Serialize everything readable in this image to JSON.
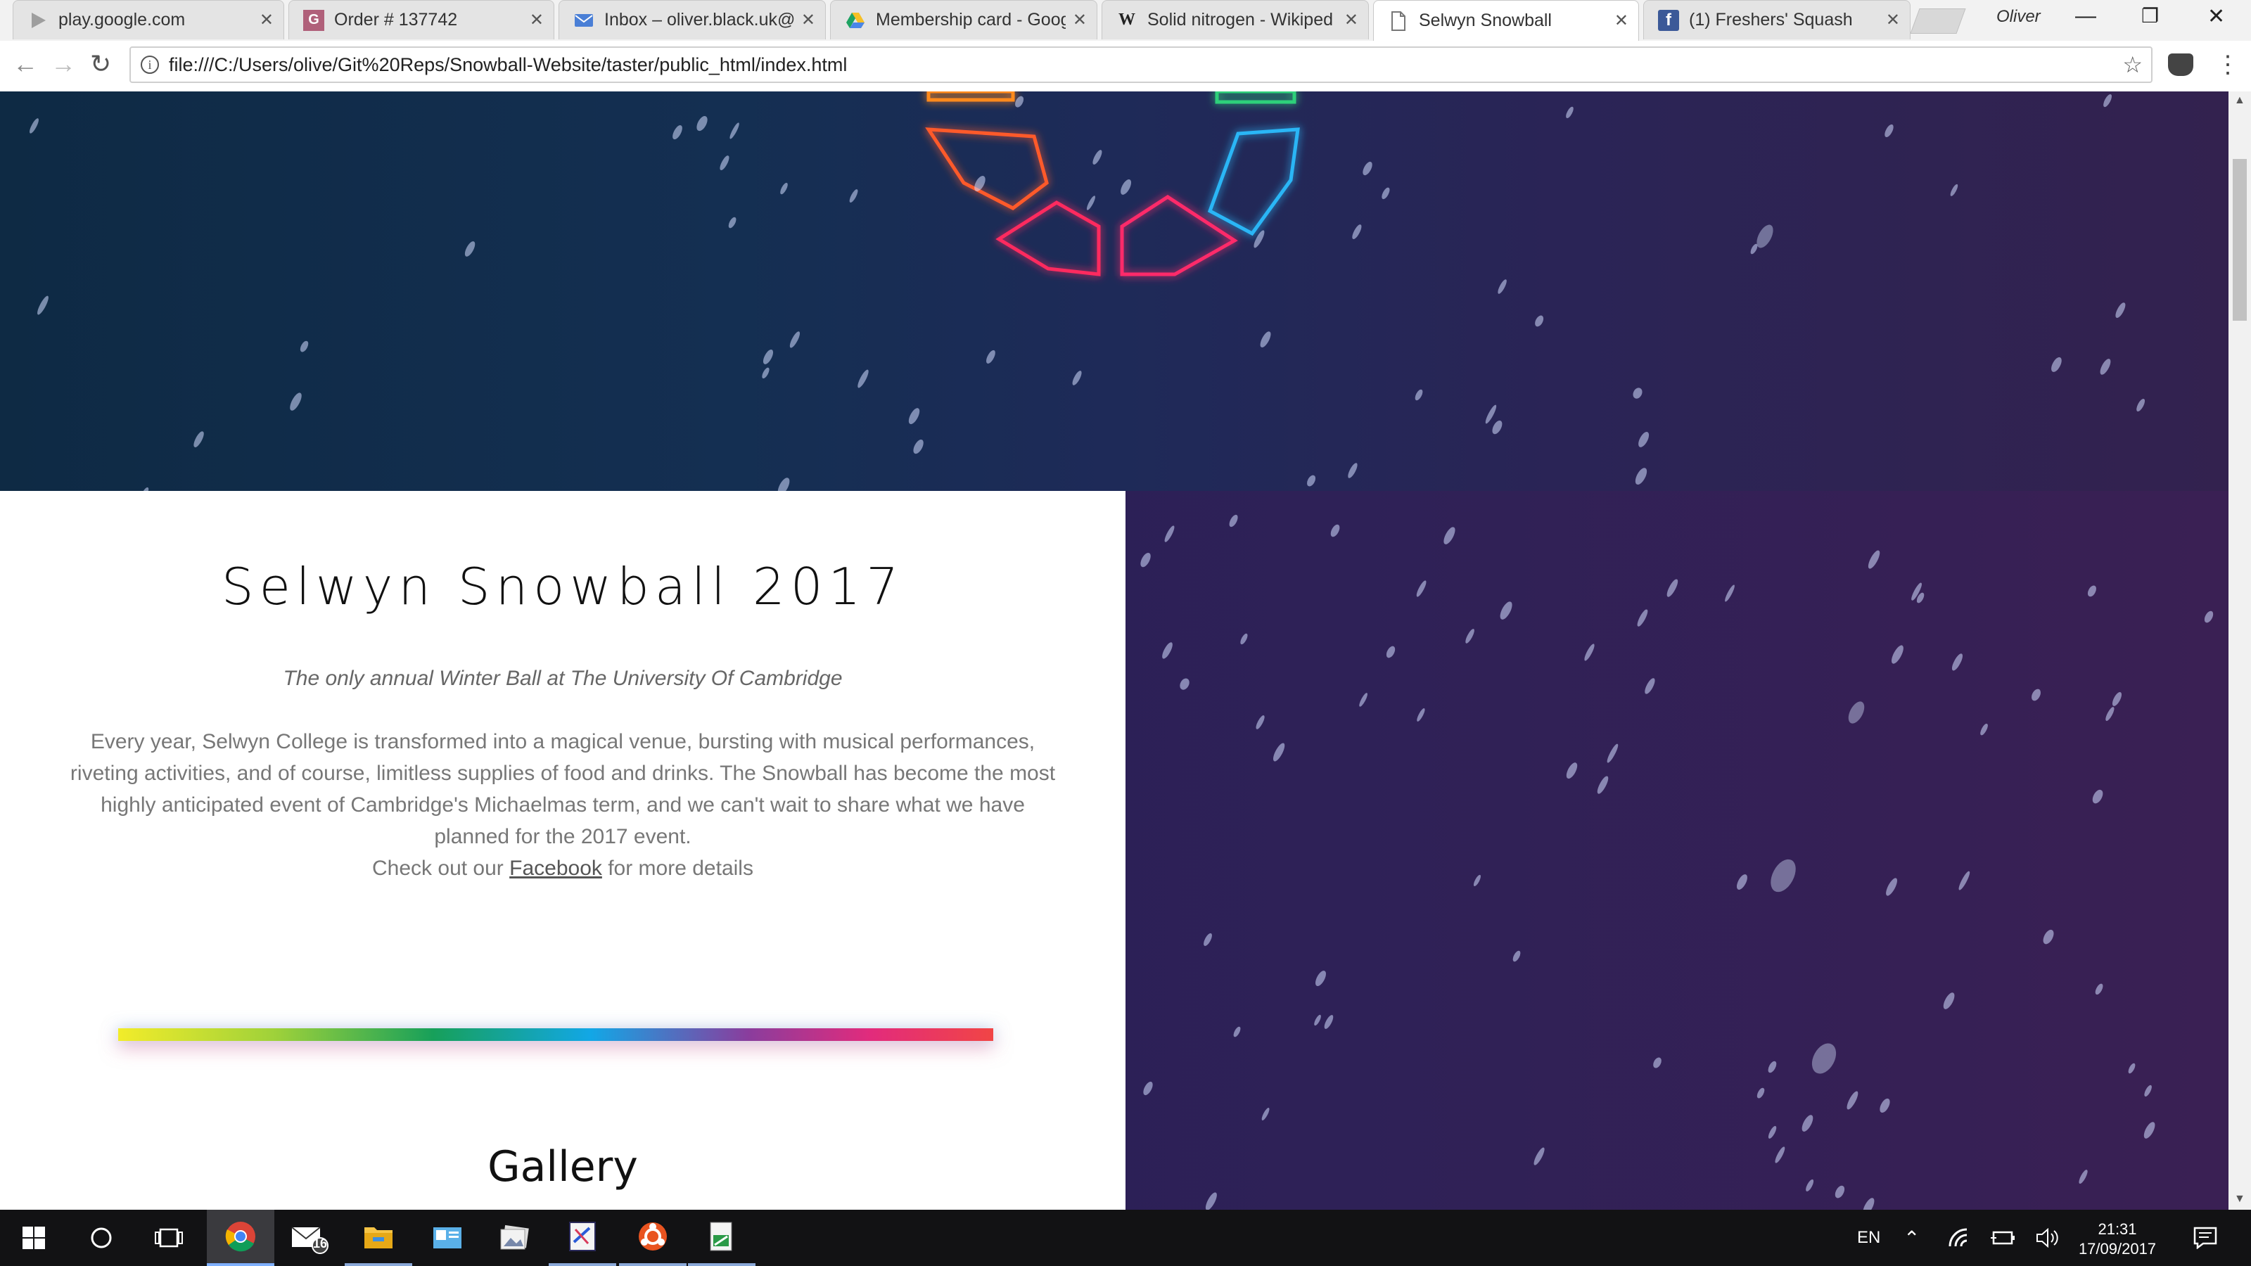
{
  "browser": {
    "tabs": [
      {
        "title": "play.google.com",
        "icon": "google-play-icon",
        "active": false
      },
      {
        "title": "Order # 137742",
        "icon": "g-square-icon",
        "active": false
      },
      {
        "title": "Inbox – oliver.black.uk@",
        "icon": "inbox-icon",
        "active": false
      },
      {
        "title": "Membership card - Goog",
        "icon": "google-drive-icon",
        "active": false
      },
      {
        "title": "Solid nitrogen - Wikiped",
        "icon": "wikipedia-icon",
        "active": false
      },
      {
        "title": "Selwyn Snowball",
        "icon": "document-icon",
        "active": true
      },
      {
        "title": "(1) Freshers' Squash",
        "icon": "facebook-icon",
        "active": false
      }
    ],
    "profile_name": "Oliver",
    "url": "file:///C:/Users/olive/Git%20Reps/Snowball-Website/taster/public_html/index.html"
  },
  "page": {
    "title": "Selwyn Snowball 2017",
    "tagline": "The only annual Winter Ball at The University Of Cambridge",
    "description": "Every year, Selwyn College is transformed into a magical venue, bursting with musical performances, riveting activities, and of course, limitless supplies of food and drinks. The Snowball has become the most highly anticipated event of Cambridge's Michaelmas term, and we can't wait to share what we have planned for the 2017 event.",
    "cta_prefix": "Check out our ",
    "cta_link": "Facebook",
    "cta_suffix": " for more details",
    "gallery_heading": "Gallery"
  },
  "taskbar": {
    "mail_badge": "16",
    "language": "EN",
    "time": "21:31",
    "date": "17/09/2017"
  },
  "colors": {
    "accent_chrome": "#4285f4",
    "hero_blue": "#0e2a44",
    "hero_purple": "#33224f"
  }
}
